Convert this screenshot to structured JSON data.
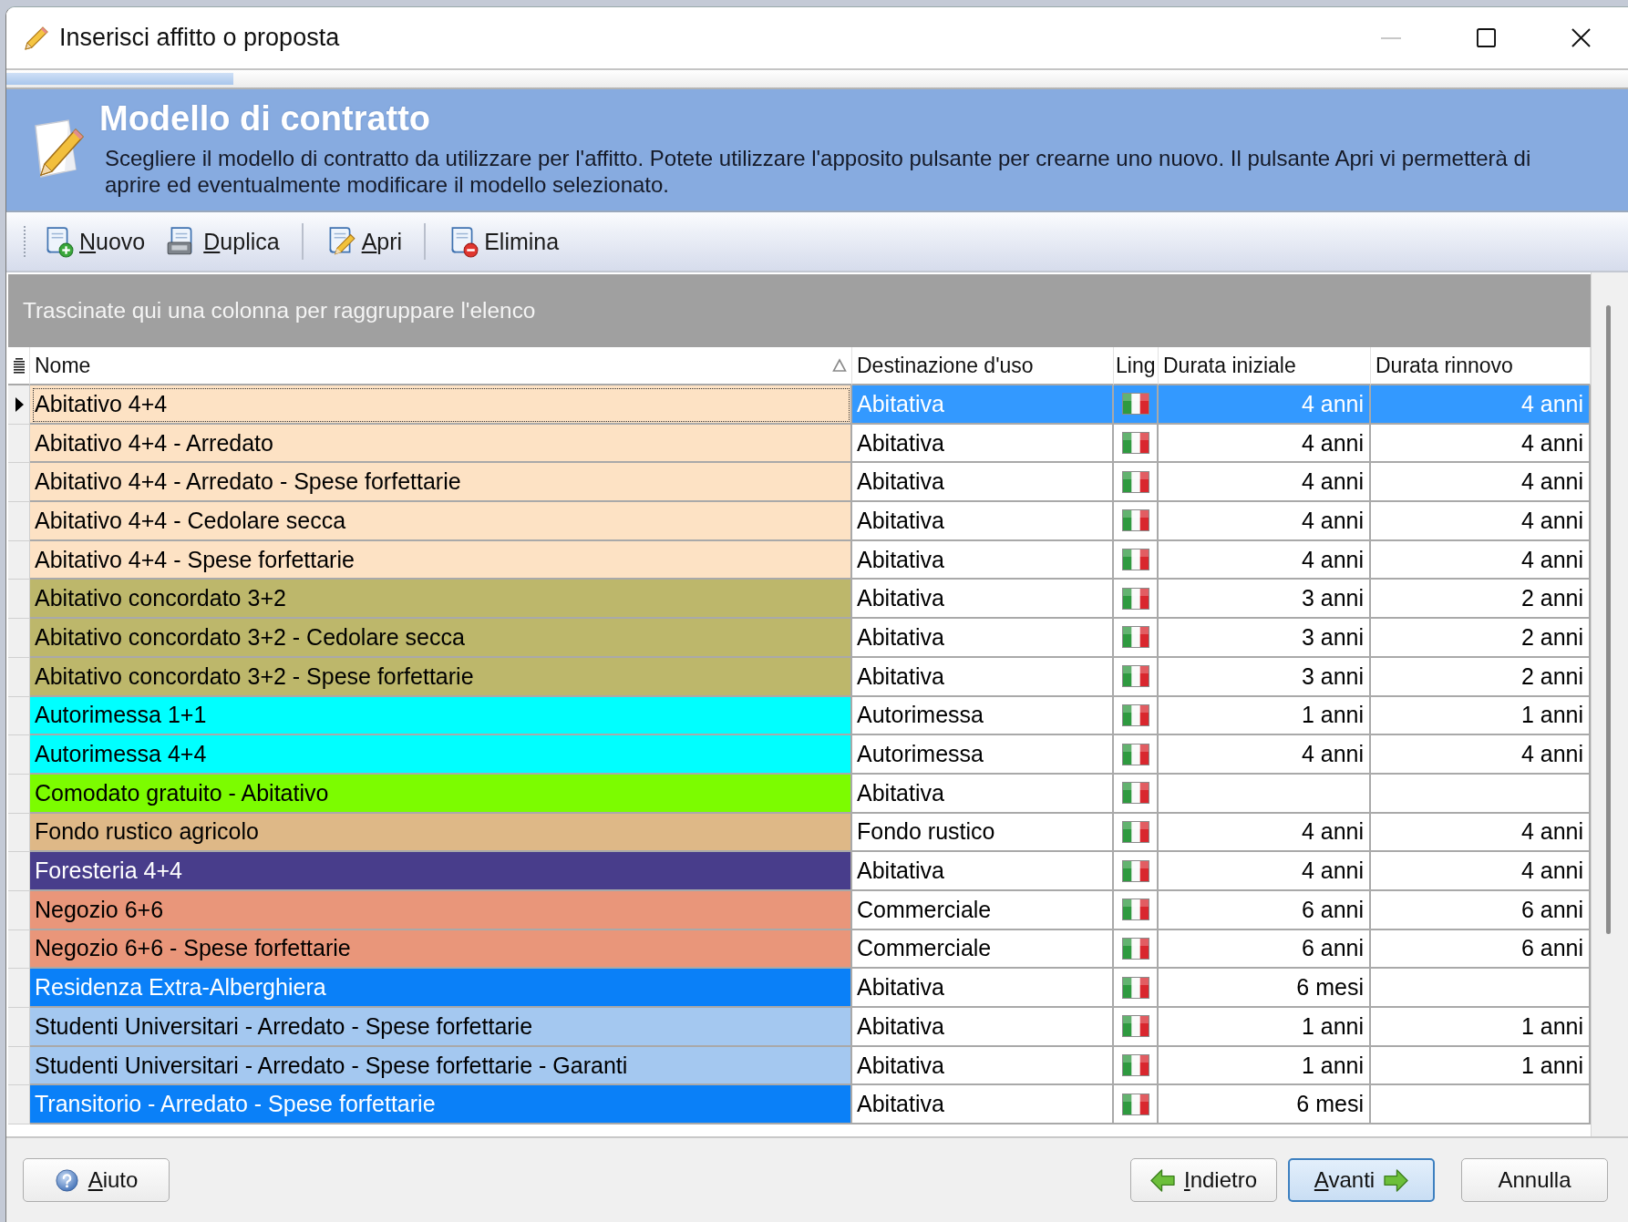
{
  "window": {
    "title": "Inserisci affitto o proposta",
    "controls": [
      {
        "kind": "minimize",
        "disabled": true
      },
      {
        "kind": "maximize",
        "disabled": false
      },
      {
        "kind": "close",
        "disabled": false
      }
    ]
  },
  "wizard_progress": {
    "level": 0.14
  },
  "header": {
    "title": "Modello di contratto",
    "description": "Scegliere il modello di contratto da utilizzare per l'affitto. Potete utilizzare l'apposito pulsante per crearne uno nuovo. Il pulsante Apri vi permetterà di aprire ed eventualmente modificare il modello selezionato."
  },
  "toolbar": [
    {
      "kind": "new",
      "label": "Nuovo",
      "mnemonic": true
    },
    {
      "kind": "duplicate",
      "label": "Duplica",
      "mnemonic": true
    },
    {
      "kind": "open",
      "label": "Apri",
      "mnemonic": true
    },
    {
      "kind": "delete",
      "label": "Elimina",
      "mnemonic": false
    }
  ],
  "group_panel": {
    "text": "Trascinate qui una colonna per raggruppare l'elenco"
  },
  "table": {
    "columns": [
      {
        "label": "Nome",
        "sorted": true
      },
      {
        "label": "Destinazione d'uso",
        "sorted": false
      },
      {
        "label": "Ling",
        "sorted": false
      },
      {
        "label": "Durata iniziale",
        "sorted": false
      },
      {
        "label": "Durata rinnovo",
        "sorted": false
      }
    ],
    "rows": [
      {
        "name": "Abitativo 4+4",
        "color": "#fde2c4",
        "use": "Abitativa",
        "initial": "4 anni",
        "renewal": "4 anni",
        "selected": true
      },
      {
        "name": "Abitativo 4+4 - Arredato",
        "color": "#fde2c4",
        "use": "Abitativa",
        "initial": "4 anni",
        "renewal": "4 anni",
        "selected": false
      },
      {
        "name": "Abitativo 4+4 - Arredato - Spese forfettarie",
        "color": "#fde2c4",
        "use": "Abitativa",
        "initial": "4 anni",
        "renewal": "4 anni",
        "selected": false
      },
      {
        "name": "Abitativo 4+4 - Cedolare secca",
        "color": "#fde2c4",
        "use": "Abitativa",
        "initial": "4 anni",
        "renewal": "4 anni",
        "selected": false
      },
      {
        "name": "Abitativo 4+4 - Spese forfettarie",
        "color": "#fde2c4",
        "use": "Abitativa",
        "initial": "4 anni",
        "renewal": "4 anni",
        "selected": false
      },
      {
        "name": "Abitativo concordato 3+2",
        "color": "#bdb76b",
        "use": "Abitativa",
        "initial": "3 anni",
        "renewal": "2 anni",
        "selected": false
      },
      {
        "name": "Abitativo concordato 3+2 - Cedolare secca",
        "color": "#bdb76b",
        "use": "Abitativa",
        "initial": "3 anni",
        "renewal": "2 anni",
        "selected": false
      },
      {
        "name": "Abitativo concordato 3+2 - Spese forfettarie",
        "color": "#bdb76b",
        "use": "Abitativa",
        "initial": "3 anni",
        "renewal": "2 anni",
        "selected": false
      },
      {
        "name": "Autorimessa 1+1",
        "color": "#00ffff",
        "use": "Autorimessa",
        "initial": "1 anni",
        "renewal": "1 anni",
        "selected": false
      },
      {
        "name": "Autorimessa 4+4",
        "color": "#00ffff",
        "use": "Autorimessa",
        "initial": "4 anni",
        "renewal": "4 anni",
        "selected": false
      },
      {
        "name": "Comodato gratuito - Abitativo",
        "color": "#7cfc00",
        "use": "Abitativa",
        "selected": false
      },
      {
        "name": "Fondo rustico agricolo",
        "color": "#deb887",
        "use": "Fondo rustico",
        "initial": "4 anni",
        "renewal": "4 anni",
        "selected": false
      },
      {
        "name": "Foresteria 4+4",
        "color": "#483d8b",
        "use": "Abitativa",
        "initial": "4 anni",
        "renewal": "4 anni",
        "selected": false
      },
      {
        "name": "Negozio 6+6",
        "color": "#e9967a",
        "use": "Commerciale",
        "initial": "6 anni",
        "renewal": "6 anni",
        "selected": false
      },
      {
        "name": "Negozio 6+6 - Spese forfettarie",
        "color": "#e9967a",
        "use": "Commerciale",
        "initial": "6 anni",
        "renewal": "6 anni",
        "selected": false
      },
      {
        "name": "Residenza Extra-Alberghiera",
        "color": "#0a80f8",
        "use": "Abitativa",
        "initial": "6 mesi",
        "selected": false
      },
      {
        "name": "Studenti Universitari - Arredato - Spese forfettarie",
        "color": "#a4c8f0",
        "use": "Abitativa",
        "initial": "1 anni",
        "renewal": "1 anni",
        "selected": false
      },
      {
        "name": "Studenti Universitari - Arredato - Spese forfettarie - Garanti",
        "color": "#a4c8f0",
        "use": "Abitativa",
        "initial": "1 anni",
        "renewal": "1 anni",
        "selected": false
      },
      {
        "name": "Transitorio - Arredato - Spese forfettarie",
        "color": "#0a80f8",
        "use": "Abitativa",
        "initial": "6 mesi",
        "selected": false
      }
    ]
  },
  "buttons": [
    {
      "kind": "help",
      "label": "Aiuto",
      "mnemonic": true,
      "default": false
    },
    {
      "kind": "back",
      "label": "Indietro",
      "mnemonic": true,
      "default": false
    },
    {
      "kind": "next",
      "label": "Avanti",
      "mnemonic": true,
      "default": true
    },
    {
      "kind": "cancel",
      "label": "Annulla",
      "mnemonic": false,
      "default": false
    }
  ]
}
